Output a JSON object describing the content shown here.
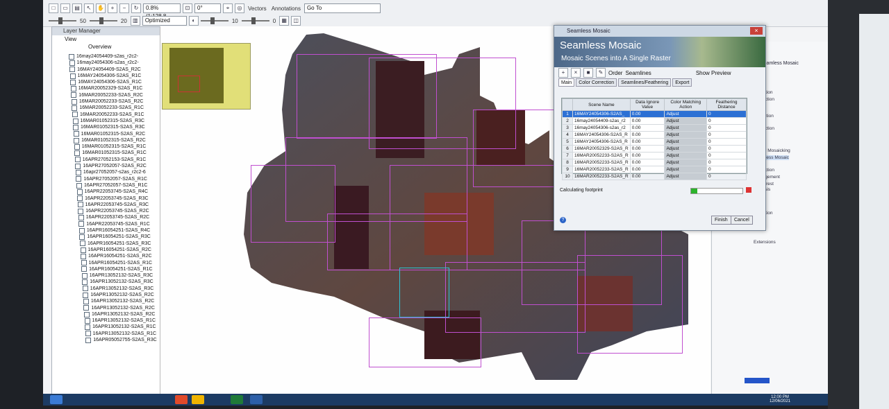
{
  "toolbar": {
    "scale_value": "0.8% (1:128.8",
    "rotation_value": "0°",
    "vectors_label": "Vectors",
    "annotations_label": "Annotations",
    "goto_label": "Go To",
    "brightness_value": "50",
    "contrast_value": "20",
    "stretch_value": "Optimized Linear",
    "sharpen_value": "10",
    "transparency_value": "0"
  },
  "layer_manager": {
    "title": "Layer Manager",
    "view_label": "View",
    "overview_label": "Overview",
    "layers": [
      "16may24054409-s2as_r2c2-",
      "16may24054306-s2as_r2c2-",
      "16MAY24054409-S2AS_R2C",
      "16MAY24054306-S2AS_R1C",
      "16MAY24054306-S2AS_R1C",
      "16MAR20052329-S2AS_R1C",
      "16MAR20052233-S2AS_R2C",
      "16MAR20052233-S2AS_R2C",
      "16MAR20052233-S2AS_R1C",
      "16MAR20052233-S2AS_R1C",
      "16MAR01052315-S2AS_R3C",
      "16MAR01052315-S2AS_R3C",
      "16MAR01052315-S2AS_R2C",
      "16MAR01052315-S2AS_R2C",
      "16MAR01052315-S2AS_R1C",
      "16MAR01052315-S2AS_R1C",
      "16APR27052153-S2AS_R1C",
      "16APR27052057-S2AS_R2C",
      "16apr27052057-s2as_r2c2-6",
      "16APR27052057-S2AS_R1C",
      "16APR27052057-S2AS_R1C",
      "16APR22053745-S2AS_R4C",
      "16APR22053745-S2AS_R3C",
      "16APR22053745-S2AS_R3C",
      "16APR22053745-S2AS_R2C",
      "16APR22053745-S2AS_R2C",
      "16APR22053745-S2AS_R1C",
      "16APR16054251-S2AS_R4C",
      "16APR16054251-S2AS_R3C",
      "16APR16054251-S2AS_R3C",
      "16APR16054251-S2AS_R2C",
      "16APR16054251-S2AS_R2C",
      "16APR16054251-S2AS_R1C",
      "16APR16054251-S2AS_R1C",
      "16APR13052132-S2AS_R3C",
      "16APR13052132-S2AS_R3C",
      "16APR13052132-S2AS_R3C",
      "16APR13052132-S2AS_R2C",
      "16APR13052132-S2AS_R2C",
      "16APR13052132-S2AS_R2C",
      "16APR13052132-S2AS_R2C",
      "16APR13052132-S2AS_R1C",
      "16APR13052132-S2AS_R1C",
      "16APR13052132-S2AS_R1C",
      "16APR05052755-S2AS_R3C"
    ]
  },
  "dialog": {
    "window_title": "Seamless Mosaic",
    "banner_title": "Seamless Mosaic",
    "banner_subtitle": "Mosaic Scenes into A Single Raster",
    "order_label": "Order",
    "seamlines_label": "Seamlines",
    "show_preview_label": "Show Preview",
    "tabs": [
      "Main",
      "Color Correction",
      "Seamlines/Feathering",
      "Export"
    ],
    "columns": [
      "Scene Name",
      "Data Ignore Value",
      "Color Matching Action",
      "Feathering Distance"
    ],
    "rows": [
      {
        "idx": "1",
        "name": "16MAY24054306-S2AS_",
        "ignore": "0.00",
        "action": "Adjust",
        "feather": "0"
      },
      {
        "idx": "2",
        "name": "16may24054409-s2as_r2",
        "ignore": "0.00",
        "action": "Adjust",
        "feather": "0"
      },
      {
        "idx": "3",
        "name": "16may24054306-s2as_r2",
        "ignore": "0.00",
        "action": "Adjust",
        "feather": "0"
      },
      {
        "idx": "4",
        "name": "16MAY24054306-S2AS_R",
        "ignore": "0.00",
        "action": "Adjust",
        "feather": "0"
      },
      {
        "idx": "5",
        "name": "16MAY24054306-S2AS_R",
        "ignore": "0.00",
        "action": "Adjust",
        "feather": "0"
      },
      {
        "idx": "6",
        "name": "16MAR20052329-S2AS_R",
        "ignore": "0.00",
        "action": "Adjust",
        "feather": "0"
      },
      {
        "idx": "7",
        "name": "16MAR20052233-S2AS_R",
        "ignore": "0.00",
        "action": "Adjust",
        "feather": "0"
      },
      {
        "idx": "8",
        "name": "16MAR20052233-S2AS_R",
        "ignore": "0.00",
        "action": "Adjust",
        "feather": "0"
      },
      {
        "idx": "9",
        "name": "16MAR20052233-S2AS_R",
        "ignore": "0.00",
        "action": "Adjust",
        "feather": "0"
      },
      {
        "idx": "10",
        "name": "16MAR20052233-S2AS_R",
        "ignore": "0.00",
        "action": "Adjust",
        "feather": "0"
      }
    ],
    "progress_label": "Calculating footprint",
    "progress_fraction": 0.12,
    "finish_label": "Finish",
    "cancel_label": "Cancel"
  },
  "toolbox": {
    "title": "Seamless Mosaic",
    "items": [
      "Detection",
      "Correction",
      "Extraction",
      "Correction",
      "Based Mosaicking",
      "Seamless Mosaic",
      "Correction",
      "Management",
      "of Interest",
      "Analysis",
      "Detection",
      "Extensions"
    ]
  },
  "taskbar": {
    "time": "12:00 PM",
    "date": "12/06/2021"
  },
  "colors": {
    "tile_border": "#c04fd0",
    "selected_tile": "#2ec4d6",
    "selection_row": "#2c70d4",
    "progress": "#2cb32c"
  }
}
